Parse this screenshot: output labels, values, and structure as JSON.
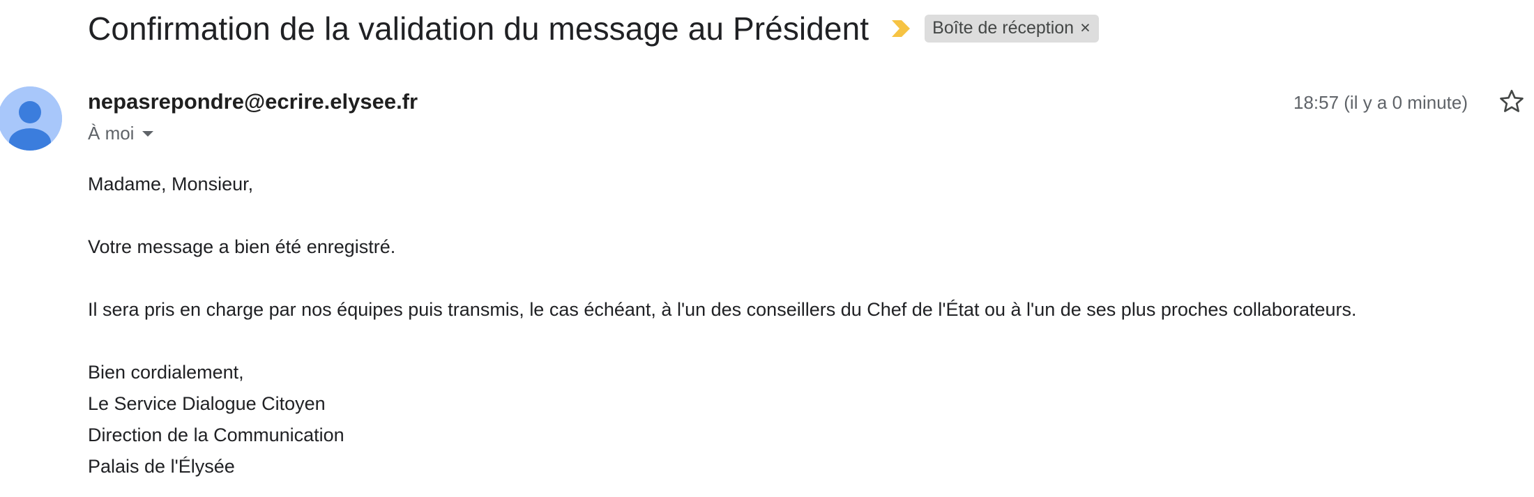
{
  "email": {
    "subject": "Confirmation de la validation du message au Président",
    "label": "Boîte de réception",
    "label_close": "×",
    "sender": "nepasrepondre@ecrire.elysee.fr",
    "recipient": "À moi",
    "timestamp": "18:57 (il y a 0 minute)",
    "body": {
      "greeting": "Madame, Monsieur,",
      "line1": "Votre message a bien été enregistré.",
      "line2": "Il sera pris en charge par nos équipes puis transmis, le cas échéant, à l'un des conseillers du Chef de l'État ou à l'un de ses plus proches collaborateurs.",
      "signoff": "Bien cordialement,",
      "signature": [
        "Le Service Dialogue Citoyen",
        "Direction de la Communication",
        "Palais de l'Élysée"
      ]
    }
  },
  "icons": {
    "importance": "importance-marker-icon",
    "avatar": "default-avatar-icon",
    "star": "star-icon",
    "caret": "chevron-down-icon"
  },
  "colors": {
    "importance": "#f6c343",
    "avatar_bg": "#a8c7fa",
    "avatar_fg": "#3b7ddd",
    "label_bg": "#dddddd"
  }
}
